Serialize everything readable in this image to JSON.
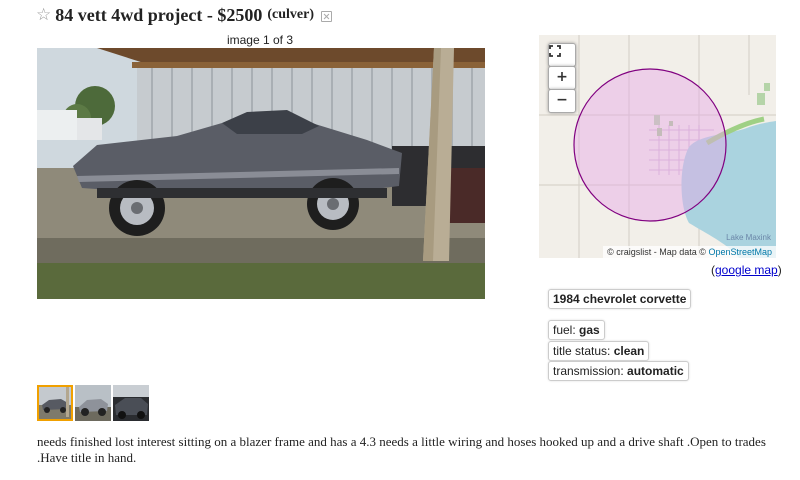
{
  "posting": {
    "title": "84 vett 4wd project - $2500",
    "location": "(culver)",
    "star_glyph": "☆"
  },
  "gallery": {
    "counter": "image 1 of 3",
    "image_count": 3,
    "selected_index": 0
  },
  "map": {
    "zoom_in": "+",
    "zoom_out": "−",
    "fullscreen_icon": "fullscreen-icon",
    "attribution_prefix": "© craigslist - Map data ©",
    "attribution_link": "OpenStreetMap",
    "lake_label": "Lake Maxink",
    "google_link": "google map",
    "colors": {
      "land": "#f2efe9",
      "water": "#aad3df",
      "circle_fill": "#e8c8e8",
      "circle_stroke": "#800080"
    }
  },
  "attributes": {
    "vehicle": "1984 chevrolet corvette",
    "fuel_label": "fuel:",
    "fuel_value": "gas",
    "title_status_label": "title status:",
    "title_status_value": "clean",
    "transmission_label": "transmission:",
    "transmission_value": "automatic"
  },
  "description": "needs finished lost interest sitting on a blazer frame and has a 4.3 needs a little wiring and hoses hooked up and a drive shaft .Open to trades .Have title in hand."
}
